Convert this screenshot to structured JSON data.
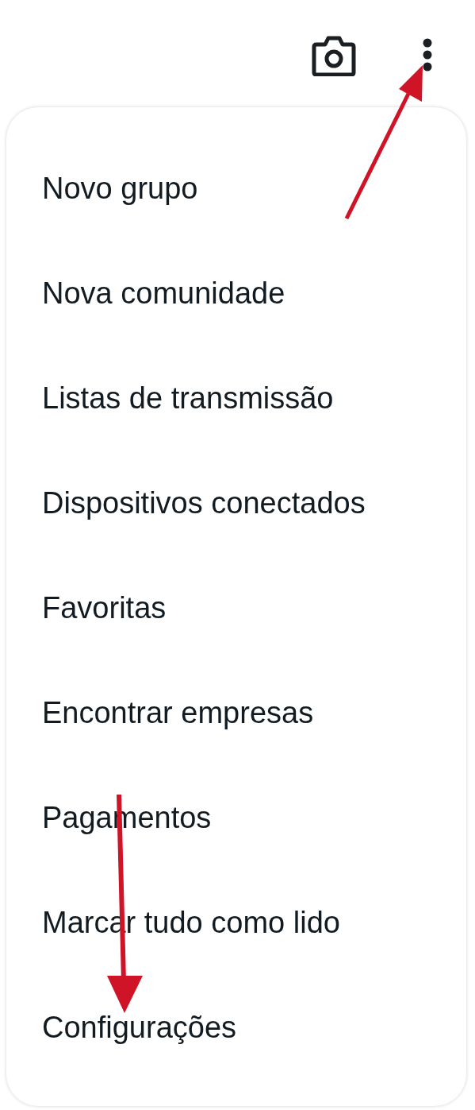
{
  "menu": {
    "items": [
      {
        "label": "Novo grupo"
      },
      {
        "label": "Nova comunidade"
      },
      {
        "label": "Listas de transmissão"
      },
      {
        "label": "Dispositivos conectados"
      },
      {
        "label": "Favoritas"
      },
      {
        "label": "Encontrar empresas"
      },
      {
        "label": "Pagamentos"
      },
      {
        "label": "Marcar tudo como lido"
      },
      {
        "label": "Configurações"
      }
    ]
  }
}
